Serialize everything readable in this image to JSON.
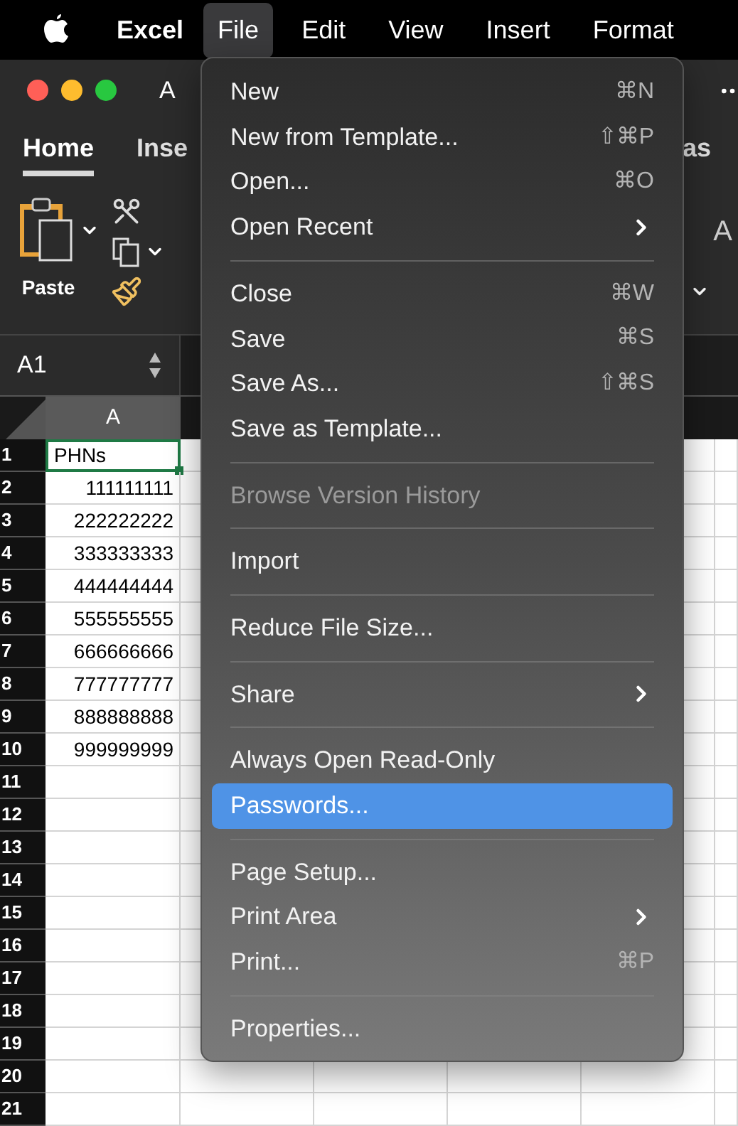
{
  "menubar": {
    "app": "Excel",
    "items": [
      {
        "label": "File",
        "selected": true
      },
      {
        "label": "Edit",
        "selected": false
      },
      {
        "label": "View",
        "selected": false
      },
      {
        "label": "Insert",
        "selected": false
      },
      {
        "label": "Format",
        "selected": false
      }
    ]
  },
  "window": {
    "title": "A"
  },
  "ribbon_tabs": [
    {
      "label": "Home",
      "selected": true
    },
    {
      "label": "Inse",
      "selected": false
    },
    {
      "label": "as",
      "selected": false
    }
  ],
  "ribbon": {
    "paste_label": "Paste",
    "font_size_label": "A"
  },
  "name_box": {
    "value": "A1"
  },
  "sheet": {
    "columns": [
      "A"
    ],
    "rows": [
      {
        "number": "1",
        "cell": "PHNs",
        "kind": "text",
        "selected": true
      },
      {
        "number": "2",
        "cell": "111111111",
        "kind": "number",
        "selected": false
      },
      {
        "number": "3",
        "cell": "222222222",
        "kind": "number",
        "selected": false
      },
      {
        "number": "4",
        "cell": "333333333",
        "kind": "number",
        "selected": false
      },
      {
        "number": "5",
        "cell": "444444444",
        "kind": "number",
        "selected": false
      },
      {
        "number": "6",
        "cell": "555555555",
        "kind": "number",
        "selected": false
      },
      {
        "number": "7",
        "cell": "666666666",
        "kind": "number",
        "selected": false
      },
      {
        "number": "8",
        "cell": "777777777",
        "kind": "number",
        "selected": false
      },
      {
        "number": "9",
        "cell": "888888888",
        "kind": "number",
        "selected": false
      },
      {
        "number": "10",
        "cell": "999999999",
        "kind": "number",
        "selected": false
      },
      {
        "number": "11"
      },
      {
        "number": "12"
      },
      {
        "number": "13"
      },
      {
        "number": "14"
      },
      {
        "number": "15"
      },
      {
        "number": "16"
      },
      {
        "number": "17"
      },
      {
        "number": "18"
      },
      {
        "number": "19"
      },
      {
        "number": "20"
      },
      {
        "number": "21"
      }
    ]
  },
  "file_menu": [
    {
      "kind": "item",
      "label": "New",
      "shortcut": "⌘N",
      "submenu": false,
      "disabled": false,
      "selected": false
    },
    {
      "kind": "item",
      "label": "New from Template...",
      "shortcut": "⇧⌘P",
      "submenu": false,
      "disabled": false,
      "selected": false
    },
    {
      "kind": "item",
      "label": "Open...",
      "shortcut": "⌘O",
      "submenu": false,
      "disabled": false,
      "selected": false
    },
    {
      "kind": "item",
      "label": "Open Recent",
      "submenu": true,
      "disabled": false,
      "selected": false
    },
    {
      "kind": "separator"
    },
    {
      "kind": "item",
      "label": "Close",
      "shortcut": "⌘W",
      "submenu": false,
      "disabled": false,
      "selected": false
    },
    {
      "kind": "item",
      "label": "Save",
      "shortcut": "⌘S",
      "submenu": false,
      "disabled": false,
      "selected": false
    },
    {
      "kind": "item",
      "label": "Save As...",
      "shortcut": "⇧⌘S",
      "submenu": false,
      "disabled": false,
      "selected": false
    },
    {
      "kind": "item",
      "label": "Save as Template...",
      "submenu": false,
      "disabled": false,
      "selected": false
    },
    {
      "kind": "separator"
    },
    {
      "kind": "item",
      "label": "Browse Version History",
      "submenu": false,
      "disabled": true,
      "selected": false
    },
    {
      "kind": "separator"
    },
    {
      "kind": "item",
      "label": "Import",
      "submenu": false,
      "disabled": false,
      "selected": false
    },
    {
      "kind": "separator"
    },
    {
      "kind": "item",
      "label": "Reduce File Size...",
      "submenu": false,
      "disabled": false,
      "selected": false
    },
    {
      "kind": "separator"
    },
    {
      "kind": "item",
      "label": "Share",
      "submenu": true,
      "disabled": false,
      "selected": false
    },
    {
      "kind": "separator"
    },
    {
      "kind": "item",
      "label": "Always Open Read-Only",
      "submenu": false,
      "disabled": false,
      "selected": false
    },
    {
      "kind": "item",
      "label": "Passwords...",
      "submenu": false,
      "disabled": false,
      "selected": true
    },
    {
      "kind": "separator"
    },
    {
      "kind": "item",
      "label": "Page Setup...",
      "submenu": false,
      "disabled": false,
      "selected": false
    },
    {
      "kind": "item",
      "label": "Print Area",
      "submenu": true,
      "disabled": false,
      "selected": false
    },
    {
      "kind": "item",
      "label": "Print...",
      "shortcut": "⌘P",
      "submenu": false,
      "disabled": false,
      "selected": false
    },
    {
      "kind": "separator"
    },
    {
      "kind": "item",
      "label": "Properties...",
      "submenu": false,
      "disabled": false,
      "selected": false
    }
  ]
}
